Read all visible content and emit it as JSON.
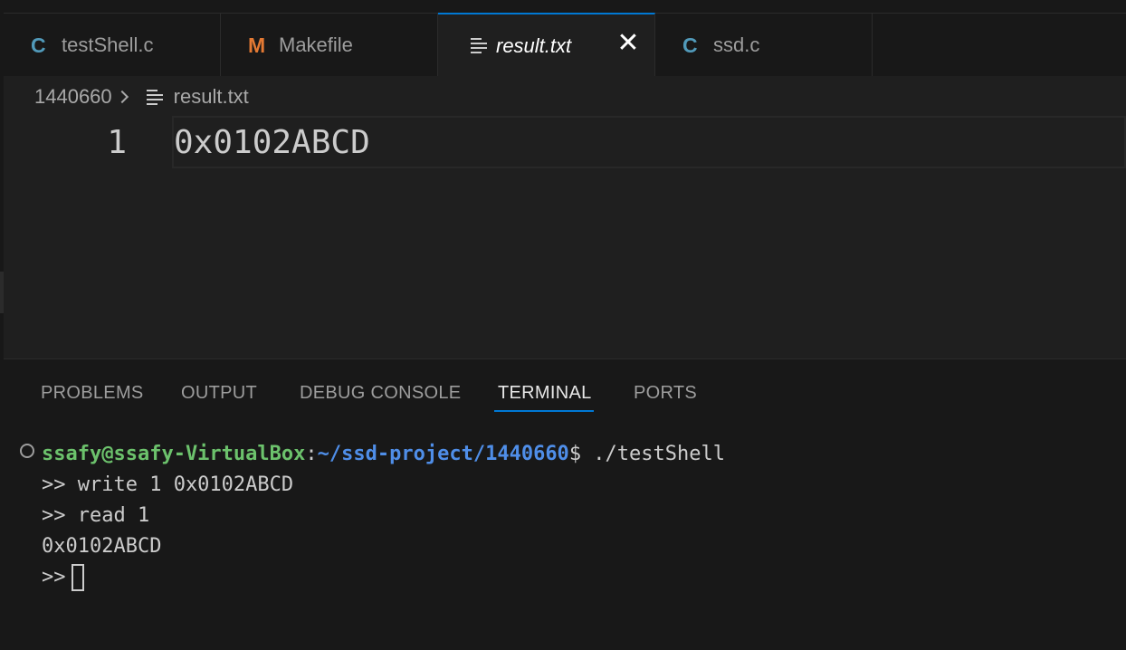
{
  "tabs": [
    {
      "icon": "C",
      "icon_name": "c-file-icon",
      "label": "testShell.c",
      "active": false
    },
    {
      "icon": "M",
      "icon_name": "makefile-icon",
      "label": "Makefile",
      "active": false
    },
    {
      "icon_name": "text-file-icon",
      "label": "result.txt",
      "active": true,
      "close": "✕"
    },
    {
      "icon": "C",
      "icon_name": "c-file-icon",
      "label": "ssd.c",
      "active": false
    }
  ],
  "breadcrumb": {
    "folder": "1440660",
    "file": "result.txt"
  },
  "editor": {
    "line_number": "1",
    "line_content": "0x0102ABCD"
  },
  "panel_tabs": [
    "PROBLEMS",
    "OUTPUT",
    "DEBUG CONSOLE",
    "TERMINAL",
    "PORTS"
  ],
  "active_panel_tab": "TERMINAL",
  "terminal": {
    "user_host": "ssafy@ssafy-VirtualBox",
    "colon": ":",
    "path": "~/ssd-project/1440660",
    "prompt_cmd": "$ ./testShell",
    "lines": [
      ">> write 1 0x0102ABCD",
      ">> read 1",
      "0x0102ABCD"
    ],
    "current_prompt": ">>"
  },
  "colors": {
    "accent": "#0078d4",
    "c_icon": "#519aba",
    "makefile_icon": "#e37933",
    "user_host": "#6cc26c",
    "path": "#4f8ee8"
  }
}
